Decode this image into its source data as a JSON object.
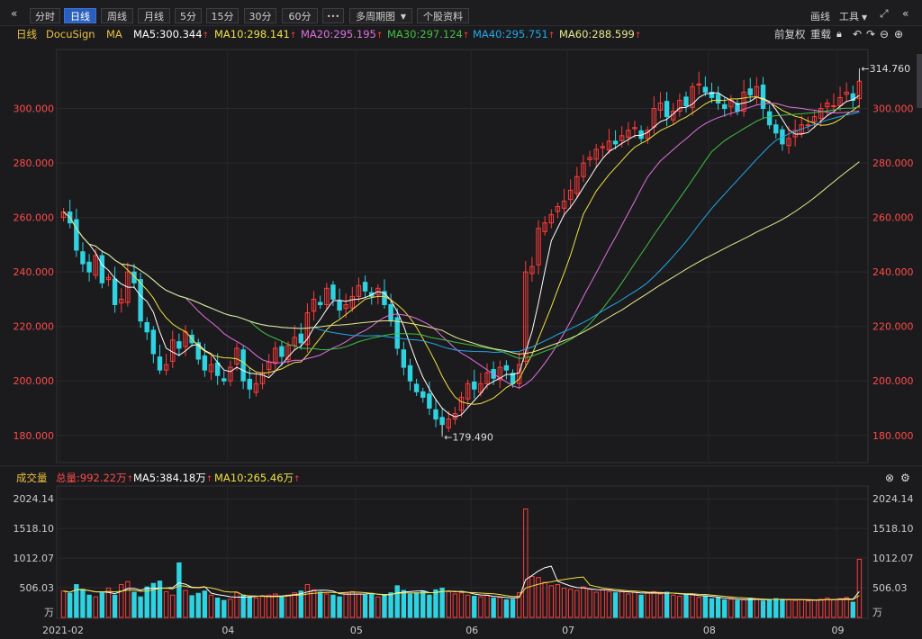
{
  "toolbar": {
    "collapse_left_icon": "double-chevron-left-icon",
    "periods": [
      "分时",
      "日线",
      "周线",
      "月线",
      "5分",
      "15分",
      "30分",
      "60分"
    ],
    "active_period": "日线",
    "more_label": "•••",
    "multi_period_label": "多周期图",
    "stock_info_label": "个股资料",
    "draw_label": "画线",
    "tools_label": "工具",
    "expand_icon": "expand-icon",
    "collapse_right_icon": "double-chevron-right-icon"
  },
  "price_legend": {
    "period": "日线",
    "name": "DocuSign",
    "indicator": "MA",
    "ma5": "MA5:300.344",
    "ma10": "MA10:298.141",
    "ma20": "MA20:295.195",
    "ma30": "MA30:297.124",
    "ma40": "MA40:295.751",
    "ma60": "MA60:288.599",
    "adjust_label": "前复权",
    "reset_label": "重载"
  },
  "volume_legend": {
    "title": "成交量",
    "total": "总量:992.22万",
    "ma5": "MA5:384.18万",
    "ma10": "MA10:265.46万"
  },
  "colors": {
    "up": "#ff3b3b",
    "down": "#2fd2e0",
    "ma5": "#ffffff",
    "ma10": "#f0e040",
    "ma20": "#e070e0",
    "ma30": "#40c040",
    "ma40": "#20a8e8",
    "ma60": "#e8e890",
    "axis_text_price": "#ff4a4a",
    "axis_text_volume": "#cccccc"
  },
  "chart_data": {
    "type": "candlestick",
    "price_axis": {
      "ticks": [
        "180.000",
        "200.000",
        "220.000",
        "240.000",
        "260.000",
        "280.000",
        "300.000"
      ],
      "ylim": [
        172,
        320
      ]
    },
    "volume_axis": {
      "ticks": [
        "2024.14",
        "1518.10",
        "1012.07",
        "506.03"
      ],
      "unit": "万",
      "ylim": [
        0,
        2150
      ]
    },
    "x_labels": [
      "2021-02",
      "04",
      "05",
      "06",
      "07",
      "08",
      "09"
    ],
    "annotations": {
      "high": "314.760",
      "low": "179.490"
    },
    "closes": [
      262,
      258,
      248,
      243,
      240,
      246,
      236,
      238,
      228,
      230,
      240,
      236,
      222,
      218,
      210,
      204,
      206,
      215,
      212,
      218,
      214,
      208,
      204,
      206,
      202,
      200,
      205,
      212,
      200,
      197,
      199,
      203,
      207,
      212,
      209,
      213,
      216,
      214,
      225,
      230,
      228,
      234,
      230,
      226,
      228,
      231,
      235,
      233,
      231,
      234,
      228,
      222,
      212,
      205,
      200,
      196,
      194,
      190,
      186,
      184,
      186,
      188,
      194,
      199,
      197,
      199,
      203,
      201,
      205,
      204,
      199,
      206,
      240,
      242,
      256,
      258,
      261,
      264,
      266,
      270,
      275,
      280,
      282,
      285,
      286,
      288,
      287,
      290,
      292,
      293,
      289,
      292,
      300,
      302,
      297,
      299,
      303,
      301,
      308,
      309,
      306,
      304,
      302,
      300,
      303,
      299,
      306,
      305,
      308,
      300,
      294,
      291,
      287,
      289,
      292,
      294,
      294,
      297,
      300,
      302,
      301,
      304,
      306,
      303,
      310
    ],
    "volumes": [
      450,
      410,
      560,
      480,
      380,
      350,
      420,
      500,
      380,
      560,
      610,
      430,
      350,
      520,
      580,
      620,
      440,
      380,
      930,
      460,
      370,
      410,
      450,
      380,
      330,
      290,
      310,
      420,
      380,
      350,
      330,
      360,
      380,
      400,
      360,
      380,
      420,
      450,
      560,
      470,
      430,
      400,
      380,
      350,
      420,
      440,
      400,
      380,
      410,
      350,
      380,
      420,
      540,
      460,
      400,
      420,
      450,
      380,
      470,
      500,
      440,
      400,
      420,
      380,
      360,
      350,
      380,
      330,
      340,
      300,
      310,
      420,
      1850,
      700,
      680,
      600,
      540,
      560,
      500,
      480,
      460,
      520,
      480,
      430,
      470,
      440,
      420,
      450,
      400,
      430,
      380,
      420,
      440,
      400,
      430,
      380,
      360,
      400,
      380,
      340,
      360,
      320,
      330,
      300,
      310,
      290,
      300,
      330,
      310,
      280,
      300,
      320,
      310,
      300,
      290,
      300,
      280,
      300,
      310,
      330,
      300,
      320,
      340,
      260,
      992
    ]
  }
}
